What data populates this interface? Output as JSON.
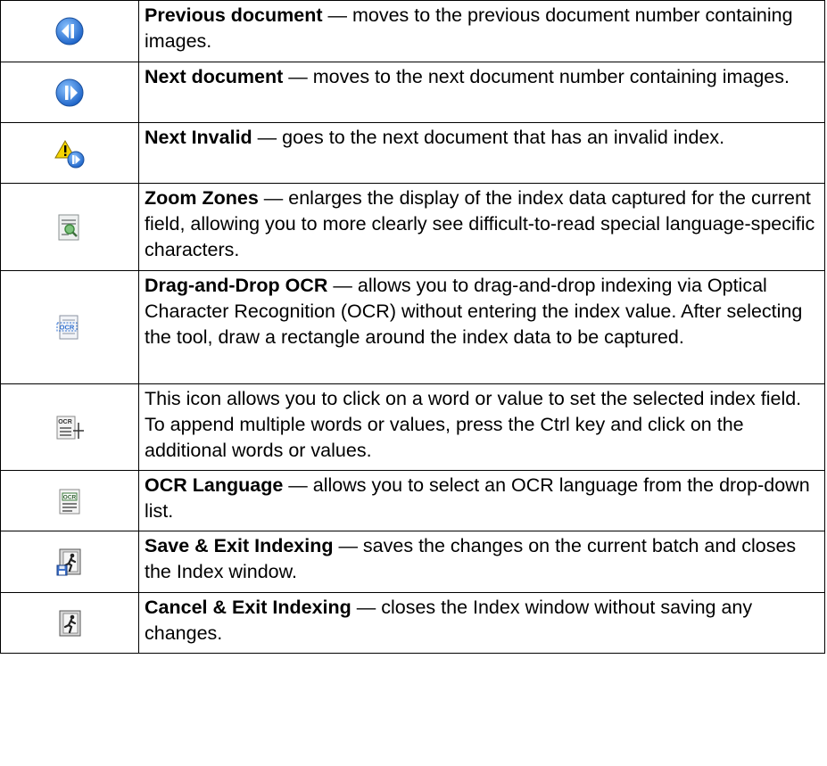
{
  "rows": [
    {
      "icon": "previous-document-icon",
      "term": "Previous document",
      "text": " — moves to the previous document number containing images."
    },
    {
      "icon": "next-document-icon",
      "term": "Next document",
      "text": " — moves to the next document number containing images."
    },
    {
      "icon": "next-invalid-icon",
      "term": "Next Invalid",
      "text": " — goes to the next document that has an invalid index."
    },
    {
      "icon": "zoom-zones-icon",
      "term": "Zoom Zones",
      "text": " — enlarges the display of the index data captured for the current field, allowing you to more clearly see difficult-to-read special language-specific characters."
    },
    {
      "icon": "drag-and-drop-ocr-icon",
      "term": "Drag-and-Drop OCR",
      "text": " — allows you to drag-and-drop indexing via Optical Character Recognition (OCR) without entering the index value. After selecting the tool, draw a rectangle around the index data to be captured."
    },
    {
      "icon": "click-ocr-icon",
      "term": "",
      "text": "This icon allows you to click on a word or value to set the selected index field. To append multiple words or values, press the Ctrl key and click on the additional words or values."
    },
    {
      "icon": "ocr-language-icon",
      "term": "OCR Language",
      "text": " — allows you to select an OCR language from the drop-down list."
    },
    {
      "icon": "save-exit-indexing-icon",
      "term": "Save & Exit Indexing",
      "text": " — saves the changes on the current batch and closes the Index window."
    },
    {
      "icon": "cancel-exit-indexing-icon",
      "term": "Cancel & Exit Indexing",
      "text": " — closes the Index window without saving any changes."
    }
  ],
  "icon_labels": {
    "ocr": "OCR"
  },
  "colors": {
    "nav_blue": "#2f7fd6",
    "warning_yellow": "#f5d400",
    "border": "#000000"
  }
}
